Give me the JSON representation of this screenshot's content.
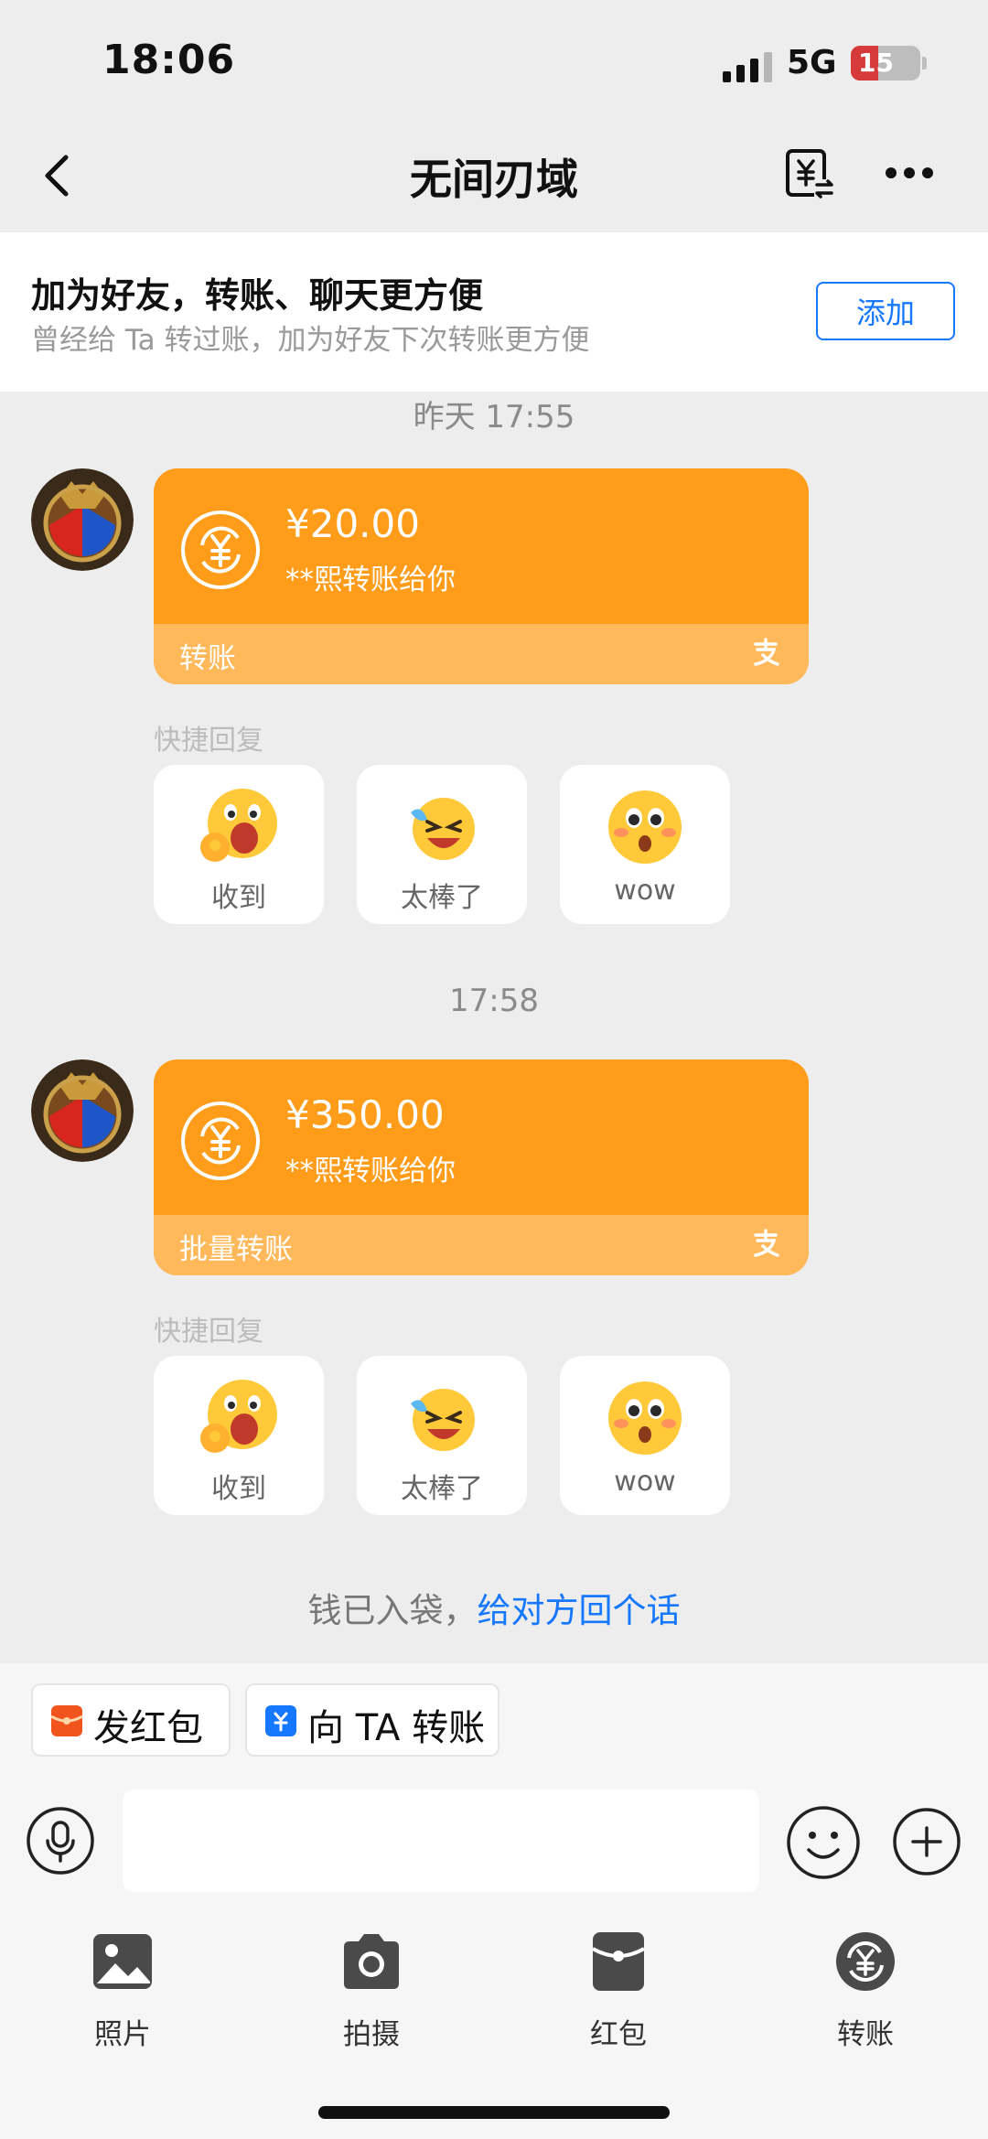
{
  "status_bar": {
    "time": "18:06",
    "network": "5G",
    "battery": "15",
    "battery_level": 0.15
  },
  "nav": {
    "title": "无间刃域"
  },
  "banner": {
    "title": "加为好友，转账、聊天更方便",
    "subtitle": "曾经给 Ta 转过账，加为好友下次转账更方便",
    "button": "添加"
  },
  "messages": [
    {
      "timestamp": "昨天 17:55",
      "amount": "¥20.00",
      "description": "**熙转账给你",
      "footer_label": "转账",
      "quick_reply_label": "快捷回复",
      "quick_replies": [
        {
          "label": "收到",
          "icon": "ok-hand-emoji-icon"
        },
        {
          "label": "太棒了",
          "icon": "tears-of-joy-emoji-icon"
        },
        {
          "label": "wow",
          "icon": "surprised-emoji-icon"
        }
      ]
    },
    {
      "timestamp": "17:58",
      "amount": "¥350.00",
      "description": "**熙转账给你",
      "footer_label": "批量转账",
      "quick_reply_label": "快捷回复",
      "quick_replies": [
        {
          "label": "收到",
          "icon": "ok-hand-emoji-icon"
        },
        {
          "label": "太棒了",
          "icon": "tears-of-joy-emoji-icon"
        },
        {
          "label": "wow",
          "icon": "surprised-emoji-icon"
        }
      ]
    }
  ],
  "received_notice": {
    "text": "钱已入袋，",
    "link": "给对方回个话"
  },
  "shortcuts": [
    {
      "label": "发红包",
      "icon": "red-envelope-icon",
      "color": "#f2541d"
    },
    {
      "label": "向 TA 转账",
      "icon": "transfer-icon",
      "color": "#1677ff"
    }
  ],
  "tools": [
    {
      "label": "照片",
      "icon": "photo-icon"
    },
    {
      "label": "拍摄",
      "icon": "camera-icon"
    },
    {
      "label": "红包",
      "icon": "red-packet-icon"
    },
    {
      "label": "转账",
      "icon": "transfer-coin-icon"
    }
  ],
  "colors": {
    "accent": "#1677ff",
    "card": "#ff9c1a",
    "card_footer": "#ffb85a",
    "background": "#ededed"
  }
}
